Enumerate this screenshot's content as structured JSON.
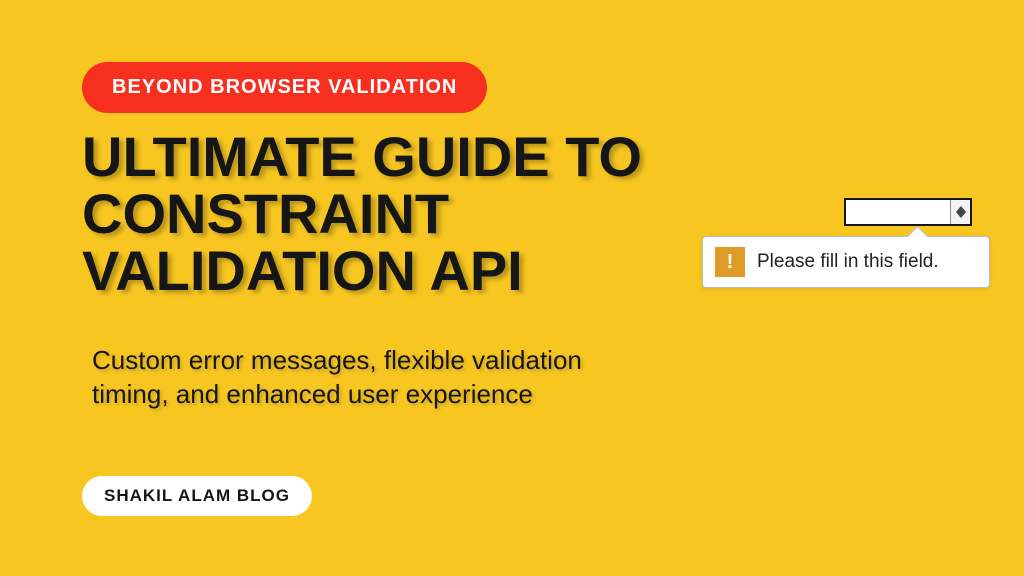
{
  "badge": "BEYOND BROWSER VALIDATION",
  "headline": "ULTIMATE GUIDE TO CONSTRAINT VALIDATION API",
  "subtext": "Custom error messages, flexible validation timing, and enhanced user experience",
  "blog_label": "SHAKIL ALAM BLOG",
  "tooltip": {
    "message": "Please fill in this field.",
    "warn_glyph": "!"
  }
}
